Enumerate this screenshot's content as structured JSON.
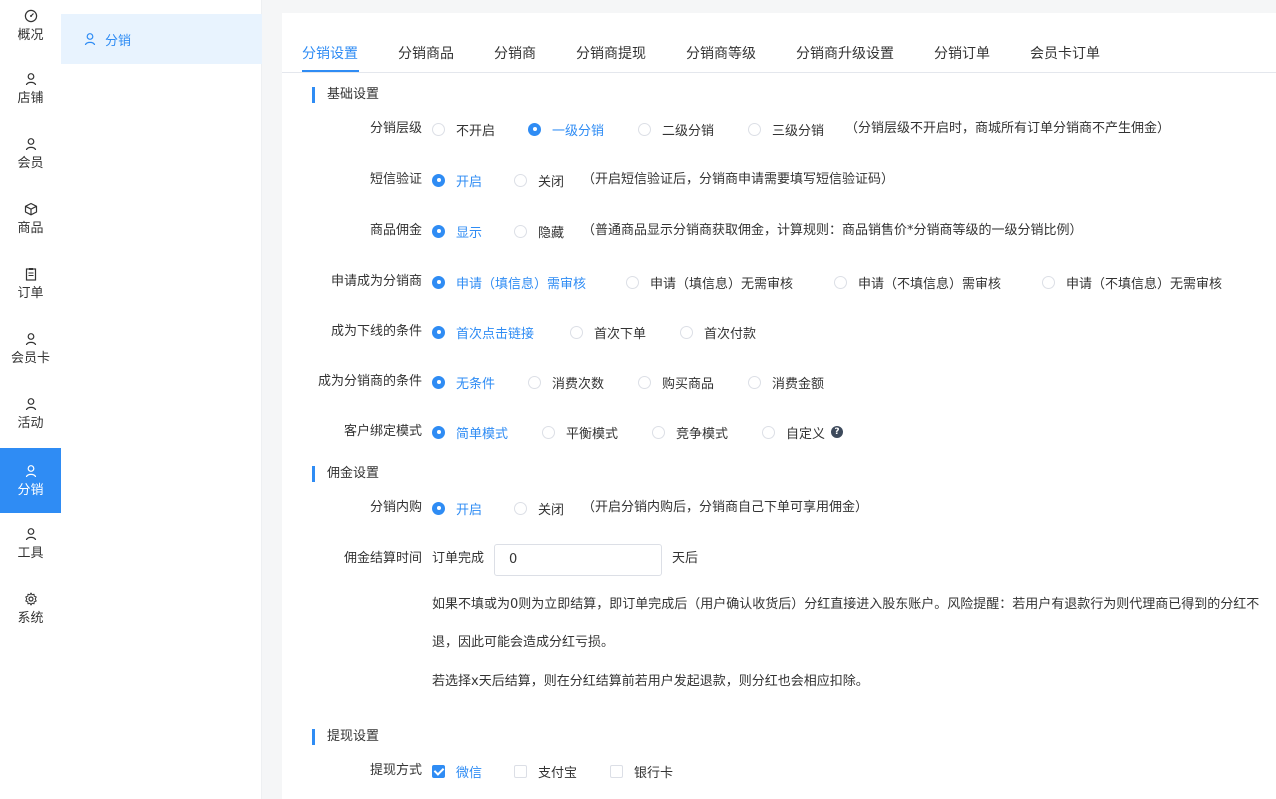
{
  "nav": {
    "items": [
      {
        "label": "概况",
        "icon": "dashboard-icon"
      },
      {
        "label": "店铺",
        "icon": "user-icon"
      },
      {
        "label": "会员",
        "icon": "user-icon"
      },
      {
        "label": "商品",
        "icon": "box-icon"
      },
      {
        "label": "订单",
        "icon": "clipboard-icon"
      },
      {
        "label": "会员卡",
        "icon": "user-icon"
      },
      {
        "label": "活动",
        "icon": "user-icon"
      },
      {
        "label": "分销",
        "icon": "user-icon"
      },
      {
        "label": "工具",
        "icon": "user-icon"
      },
      {
        "label": "系统",
        "icon": "gear-icon"
      }
    ],
    "active": "分销"
  },
  "submenu": {
    "label": "分销",
    "icon": "user-icon"
  },
  "tabs": [
    "分销设置",
    "分销商品",
    "分销商",
    "分销商提现",
    "分销商等级",
    "分销商升级设置",
    "分销订单",
    "会员卡订单"
  ],
  "sections": {
    "basic": "基础设置",
    "commission": "佣金设置",
    "withdraw": "提现设置"
  },
  "form": {
    "level": {
      "label": "分销层级",
      "options": [
        "不开启",
        "一级分销",
        "二级分销",
        "三级分销"
      ],
      "selected": "一级分销",
      "hint": "（分销层级不开启时，商城所有订单分销商不产生佣金）"
    },
    "sms": {
      "label": "短信验证",
      "options": [
        "开启",
        "关闭"
      ],
      "selected": "开启",
      "hint": "（开启短信验证后，分销商申请需要填写短信验证码）"
    },
    "goods_commission": {
      "label": "商品佣金",
      "options": [
        "显示",
        "隐藏"
      ],
      "selected": "显示",
      "hint": "（普通商品显示分销商获取佣金，计算规则：商品销售价*分销商等级的一级分销比例）"
    },
    "apply": {
      "label": "申请成为分销商",
      "options": [
        "申请（填信息）需审核",
        "申请（填信息）无需审核",
        "申请（不填信息）需审核",
        "申请（不填信息）无需审核"
      ],
      "selected": "申请（填信息）需审核"
    },
    "downline": {
      "label": "成为下线的条件",
      "options": [
        "首次点击链接",
        "首次下单",
        "首次付款"
      ],
      "selected": "首次点击链接"
    },
    "condition": {
      "label": "成为分销商的条件",
      "options": [
        "无条件",
        "消费次数",
        "购买商品",
        "消费金额"
      ],
      "selected": "无条件"
    },
    "binding": {
      "label": "客户绑定模式",
      "options": [
        "简单模式",
        "平衡模式",
        "竞争模式",
        "自定义"
      ],
      "selected": "简单模式",
      "help_icon": "question-icon"
    },
    "inner_buy": {
      "label": "分销内购",
      "options": [
        "开启",
        "关闭"
      ],
      "selected": "开启",
      "hint": "（开启分销内购后，分销商自己下单可享用佣金）"
    },
    "settle": {
      "label": "佣金结算时间",
      "prefix": "订单完成",
      "value": "0",
      "suffix": "天后"
    },
    "settle_note1": "如果不填或为0则为立即结算，即订单完成后（用户确认收货后）分红直接进入股东账户。风险提醒：若用户有退款行为则代理商已得到的分红不退，因此可能会造成分红亏损。",
    "settle_note2": "若选择x天后结算，则在分红结算前若用户发起退款，则分红也会相应扣除。",
    "withdraw_method": {
      "label": "提现方式",
      "options": [
        "微信",
        "支付宝",
        "银行卡"
      ],
      "checked": [
        "微信"
      ]
    }
  }
}
